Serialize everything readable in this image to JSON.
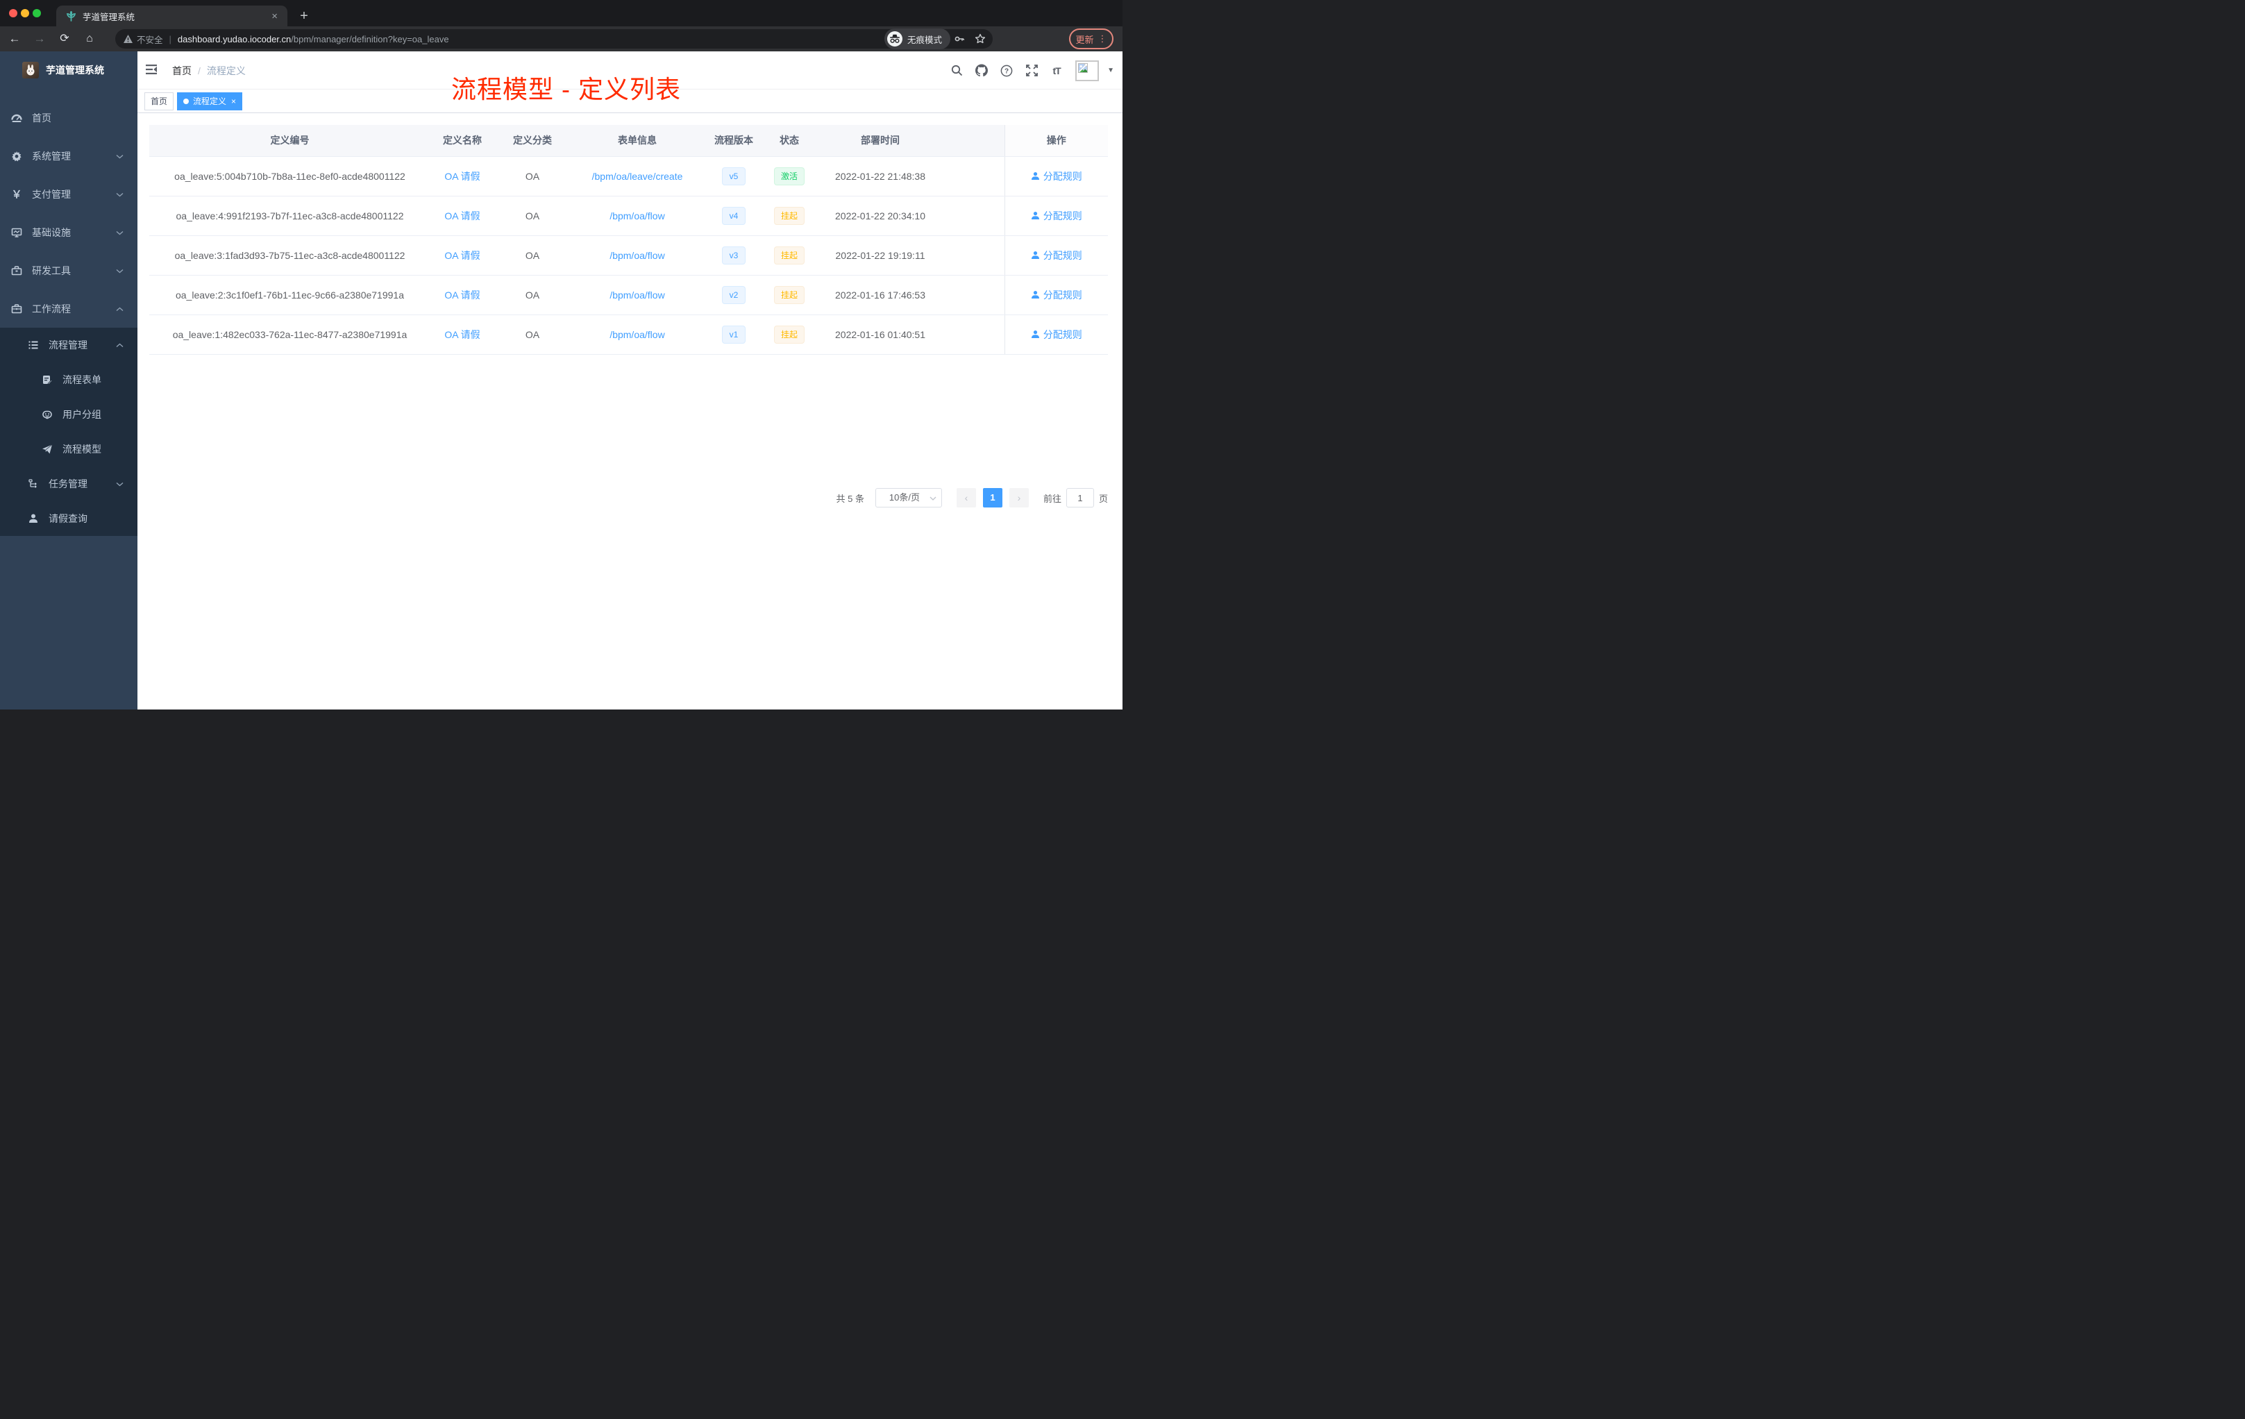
{
  "browser": {
    "tab": {
      "title": "芋道管理系统",
      "close": "×",
      "new_tab": "+"
    },
    "toolbar": {
      "back": "←",
      "forward": "→",
      "reload": "⟳",
      "home": "⌂",
      "security_warning": "不安全",
      "url_host": "dashboard.yudao.iocoder.cn",
      "url_path": "/bpm/manager/definition?key=oa_leave",
      "incognito_label": "无痕模式",
      "update_label": "更新",
      "kebab": "⋮"
    }
  },
  "sidebar": {
    "logo_title": "芋道管理系统",
    "items": [
      {
        "label": "首页"
      },
      {
        "label": "系统管理"
      },
      {
        "label": "支付管理"
      },
      {
        "label": "基础设施"
      },
      {
        "label": "研发工具"
      },
      {
        "label": "工作流程"
      }
    ],
    "submenu": {
      "items": [
        {
          "label": "流程管理"
        },
        {
          "label": "流程表单"
        },
        {
          "label": "用户分组"
        },
        {
          "label": "流程模型"
        },
        {
          "label": "任务管理"
        },
        {
          "label": "请假查询"
        }
      ]
    }
  },
  "header": {
    "breadcrumb": {
      "home": "首页",
      "separator": "/",
      "current": "流程定义"
    },
    "annotation": "流程模型 - 定义列表"
  },
  "tags": {
    "home": "首页",
    "active": "流程定义",
    "close": "×"
  },
  "table": {
    "columns": [
      "定义编号",
      "定义名称",
      "定义分类",
      "表单信息",
      "流程版本",
      "状态",
      "部署时间",
      "操作"
    ],
    "rows": [
      {
        "id": "oa_leave:5:004b710b-7b8a-11ec-8ef0-acde48001122",
        "name": "OA 请假",
        "category": "OA",
        "form": "/bpm/oa/leave/create",
        "version": "v5",
        "status": "激活",
        "time": "2022-01-22 21:48:38",
        "action": "分配规则"
      },
      {
        "id": "oa_leave:4:991f2193-7b7f-11ec-a3c8-acde48001122",
        "name": "OA 请假",
        "category": "OA",
        "form": "/bpm/oa/flow",
        "version": "v4",
        "status": "挂起",
        "time": "2022-01-22 20:34:10",
        "action": "分配规则"
      },
      {
        "id": "oa_leave:3:1fad3d93-7b75-11ec-a3c8-acde48001122",
        "name": "OA 请假",
        "category": "OA",
        "form": "/bpm/oa/flow",
        "version": "v3",
        "status": "挂起",
        "time": "2022-01-22 19:19:11",
        "action": "分配规则"
      },
      {
        "id": "oa_leave:2:3c1f0ef1-76b1-11ec-9c66-a2380e71991a",
        "name": "OA 请假",
        "category": "OA",
        "form": "/bpm/oa/flow",
        "version": "v2",
        "status": "挂起",
        "time": "2022-01-16 17:46:53",
        "action": "分配规则"
      },
      {
        "id": "oa_leave:1:482ec033-762a-11ec-8477-a2380e71991a",
        "name": "OA 请假",
        "category": "OA",
        "form": "/bpm/oa/flow",
        "version": "v1",
        "status": "挂起",
        "time": "2022-01-16 01:40:51",
        "action": "分配规则"
      }
    ]
  },
  "pagination": {
    "total": "共 5 条",
    "page_size": "10条/页",
    "prev": "‹",
    "page": "1",
    "next": "›",
    "goto_label": "前往",
    "goto_value": "1",
    "goto_suffix": "页"
  },
  "colors": {
    "accent_blue": "#409eff",
    "success_green": "#13ce66",
    "warning_yellow": "#ffba00",
    "sidebar_bg": "#304156",
    "submenu_bg": "#1f2d3d",
    "annotation_red": "#ff2b00"
  }
}
